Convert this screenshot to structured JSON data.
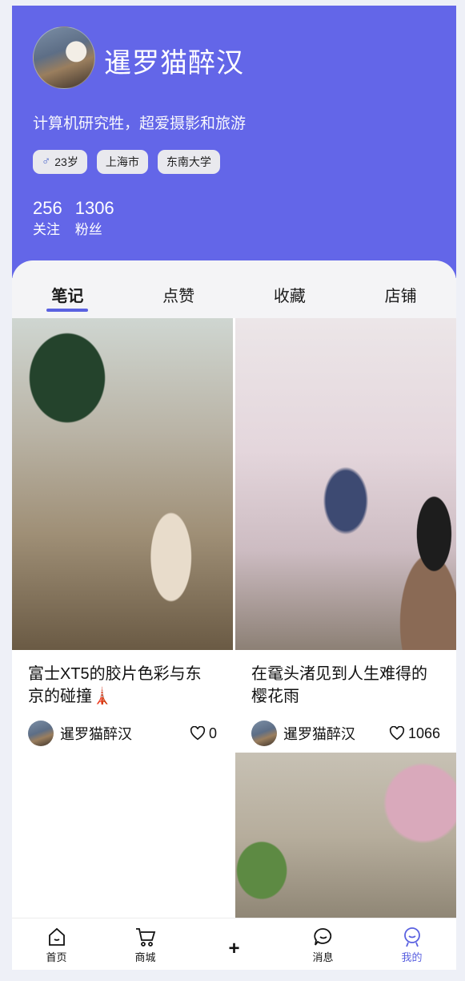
{
  "profile": {
    "username": "暹罗猫醉汉",
    "bio": "计算机研究牲，超爱摄影和旅游",
    "tags": [
      {
        "icon": "male-icon",
        "symbol": "♂",
        "label": "23岁"
      },
      {
        "label": "上海市"
      },
      {
        "label": "东南大学"
      }
    ],
    "stats": [
      {
        "value": "256",
        "label": "关注"
      },
      {
        "value": "1306",
        "label": "粉丝"
      }
    ]
  },
  "tabs": [
    {
      "label": "笔记",
      "active": true
    },
    {
      "label": "点赞",
      "active": false
    },
    {
      "label": "收藏",
      "active": false
    },
    {
      "label": "店铺",
      "active": false
    }
  ],
  "notes": [
    {
      "title": "富士XT5的胶片色彩与东京的碰撞🗼",
      "author": "暹罗猫醉汉",
      "likes": "0"
    },
    {
      "title": "在鼋头渚见到人生难得的樱花雨",
      "author": "暹罗猫醉汉",
      "likes": "1066"
    }
  ],
  "bottom_nav": [
    {
      "icon": "home-icon",
      "label": "首页"
    },
    {
      "icon": "cart-icon",
      "label": "商城"
    },
    {
      "icon": "plus-icon",
      "symbol": "+"
    },
    {
      "icon": "message-icon",
      "label": "消息"
    },
    {
      "icon": "profile-icon",
      "label": "我的",
      "active": true
    }
  ],
  "colors": {
    "header_bg": "#6366e8",
    "accent": "#5a61e0",
    "page_bg": "#eef0f7"
  }
}
